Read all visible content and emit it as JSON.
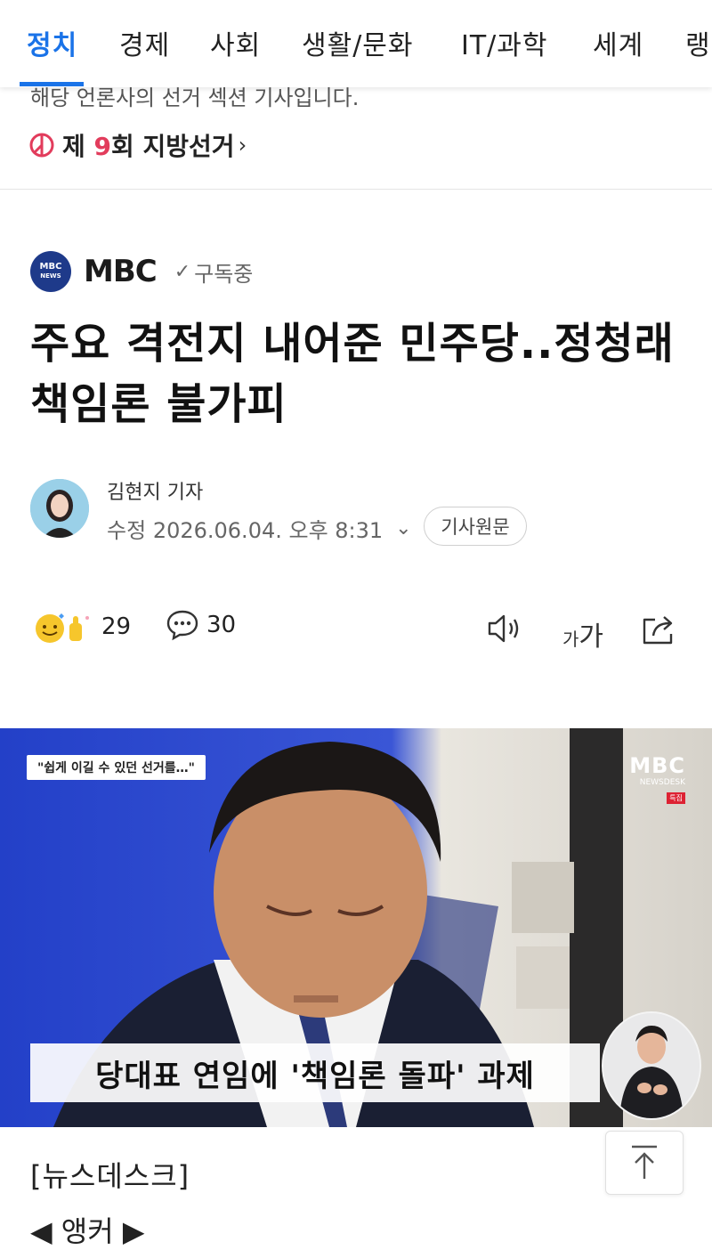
{
  "nav": {
    "tabs": [
      {
        "label": "정치",
        "active": true
      },
      {
        "label": "경제"
      },
      {
        "label": "사회"
      },
      {
        "label": "생활/문화"
      },
      {
        "label": "IT/과학"
      },
      {
        "label": "세계"
      },
      {
        "label": "랭"
      }
    ],
    "accent_color": "#1a73e8"
  },
  "notice": "해당 언론사의 선거 섹션 기사입니다.",
  "election_banner": {
    "prefix": "제",
    "number": "9",
    "suffix": "회 지방선거",
    "chevron": "›",
    "icon": "vote-mark-icon"
  },
  "press": {
    "logo_line1": "MBC",
    "logo_line2": "NEWS",
    "name": "MBC",
    "subscribe_label": "구독중",
    "brand_color": "#1e3a8a"
  },
  "article": {
    "headline": "주요 격전지 내어준 민주당..정청래 책임론 불가피",
    "reporter": "김현지 기자",
    "edited_label": "수정",
    "edited_time": "2026.06.04. 오후 8:31",
    "original_button": "기사원문"
  },
  "actions": {
    "reaction_count": "29",
    "comment_count": "30",
    "fontsize_small": "가",
    "fontsize_large": "가"
  },
  "video": {
    "quote_text": "\"쉽게 이길 수 있던 선거를…\"",
    "caption": "당대표 연임에 '책임론 돌파' 과제",
    "mbc_mark": "MBC",
    "mbc_sub": "NEWSDESK",
    "mbc_tag": "특집"
  },
  "body": {
    "section_label": "[뉴스데스크]",
    "anchor_label": "◀ 앵커 ▶"
  }
}
